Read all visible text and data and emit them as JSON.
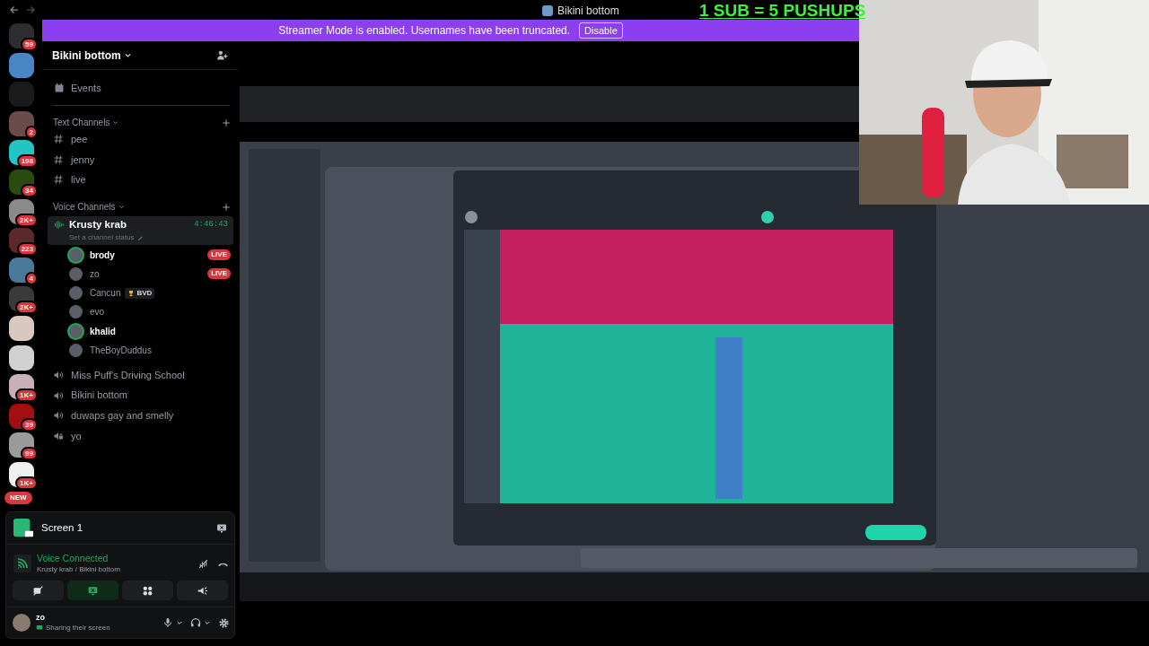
{
  "title_bar": {
    "title": "Bikini bottom",
    "overlay_text": "1 SUB = 5 PUSHUPS"
  },
  "streamer_banner": {
    "message": "Streamer Mode is enabled. Usernames have been truncated.",
    "button": "Disable"
  },
  "server_rail": {
    "servers": [
      {
        "badge": "59",
        "color": "#2b2d31"
      },
      {
        "color": "#4a86c5"
      },
      {
        "color": "#1a1a1a"
      },
      {
        "badge": "2",
        "color": "#6b4b4b"
      },
      {
        "badge": "198",
        "color": "#22c4c4"
      },
      {
        "badge": "34",
        "color": "#2a4a10"
      },
      {
        "badge": "2K+",
        "color": "#8a8a8a"
      },
      {
        "badge": "223",
        "color": "#5a2a2a"
      },
      {
        "badge": "4",
        "color": "#4a7a9a"
      },
      {
        "badge": "2K+",
        "color": "#3a3a3a"
      },
      {
        "color": "#d8c8c0"
      },
      {
        "color": "#d0d0d0"
      },
      {
        "badge": "1K+",
        "color": "#c8b0b8"
      },
      {
        "badge": "39",
        "color": "#a01010"
      },
      {
        "badge": "99",
        "color": "#9a9a9a"
      },
      {
        "badge": "1K+",
        "color": "#f0f0f0"
      }
    ],
    "new_badge": "NEW"
  },
  "channel_sidebar": {
    "server_name": "Bikini bottom",
    "events": "Events",
    "text_category": "Text Channels",
    "text_channels": [
      "pee",
      "jenny",
      "live"
    ],
    "voice_category": "Voice Channels",
    "voice_channels": [
      {
        "name": "Krusty krab",
        "kind": "voice",
        "selected": true,
        "timer": "4:46:43",
        "status_placeholder": "Set a channel status",
        "members": [
          {
            "name": "brody",
            "active": true,
            "live_badge": "LIVE"
          },
          {
            "name": "zo",
            "active": false,
            "live_badge": "LIVE"
          },
          {
            "name": "Cancun",
            "active": false,
            "tag": "BVD"
          },
          {
            "name": "evo",
            "active": false
          },
          {
            "name": "khalid",
            "active": true
          },
          {
            "name": "TheBoyDuddus",
            "active": false
          }
        ]
      },
      {
        "name": "Miss Puff's Driving School",
        "kind": "voice",
        "selected": false
      },
      {
        "name": "Bikini bottom",
        "kind": "voice",
        "selected": false
      },
      {
        "name": "duwaps gay and smelly",
        "kind": "voice",
        "selected": false
      },
      {
        "name": "yo",
        "kind": "locked",
        "selected": false
      }
    ]
  },
  "screen_share": {
    "title": "Screen 1"
  },
  "voice_panel": {
    "status": "Voice Connected",
    "location": "Krusty krab / Bikini bottom"
  },
  "user_panel": {
    "name": "zo",
    "activity": "Sharing their screen"
  }
}
